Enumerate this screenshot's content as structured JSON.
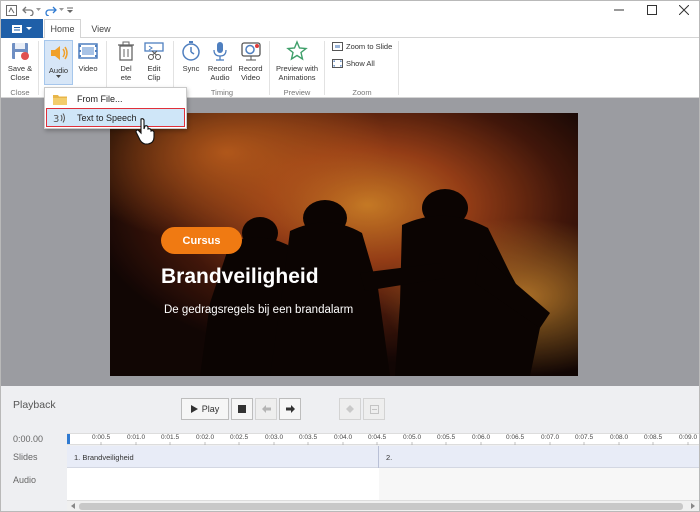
{
  "ribbon_tabs": {
    "home": "Home",
    "view": "View"
  },
  "ribbon": {
    "save_close": [
      "Save &",
      "Close"
    ],
    "audio": "Audio",
    "video": "Video",
    "delete": [
      "Del",
      "ete"
    ],
    "edit_clip": [
      "Edit",
      "Clip"
    ],
    "sync": "Sync",
    "record_audio": [
      "Record",
      "Audio"
    ],
    "record_video": [
      "Record",
      "Video"
    ],
    "preview_animations": [
      "Preview with",
      "Animations"
    ],
    "zoom_to_slide": "Zoom to Slide",
    "show_all": "Show All",
    "groups": {
      "close": "Close",
      "timing": "Timing",
      "preview": "Preview",
      "zoom": "Zoom"
    }
  },
  "audio_menu": {
    "from_file": "From File...",
    "text_to_speech": "Text to Speech"
  },
  "slide": {
    "badge": "Cursus",
    "title": "Brandveiligheid",
    "subtitle": "De gedragsregels bij een brandalarm"
  },
  "playback": {
    "label": "Playback",
    "play": "Play",
    "time": "0:00.00",
    "slides_label": "Slides",
    "audio_label": "Audio",
    "ruler": [
      "0:00.5",
      "0:01.0",
      "0:01.5",
      "0:02.0",
      "0:02.5",
      "0:03.0",
      "0:03.5",
      "0:04.0",
      "0:04.5",
      "0:05.0",
      "0:05.5",
      "0:06.0",
      "0:06.5",
      "0:07.0",
      "0:07.5",
      "0:08.0",
      "0:08.5",
      "0:09.0"
    ],
    "slides": [
      "1.  Brandveiligheid",
      "2."
    ]
  },
  "colors": {
    "file_button": "#1f5fa8",
    "badge": "#f07a12",
    "canvas_bg": "#9b9ca1",
    "menu_highlight": "#cfe6f8"
  }
}
